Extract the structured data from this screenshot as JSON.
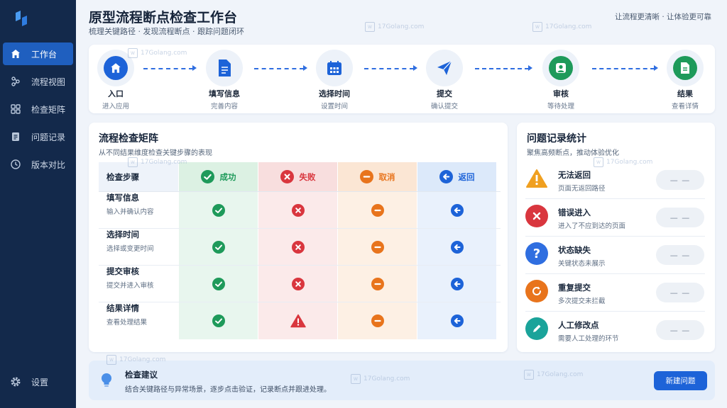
{
  "header": {
    "title": "原型流程断点检查工作台",
    "subtitle": "梳理关键路径 · 发现流程断点 · 跟踪问题闭环",
    "right_text": "让流程更清晰 · 让体验更可靠"
  },
  "sidebar": {
    "items": [
      {
        "label": "工作台",
        "icon": "home-icon"
      },
      {
        "label": "流程视图",
        "icon": "flow-icon"
      },
      {
        "label": "检查矩阵",
        "icon": "grid-icon"
      },
      {
        "label": "问题记录",
        "icon": "record-icon"
      },
      {
        "label": "版本对比",
        "icon": "clock-icon"
      }
    ],
    "bottom": {
      "label": "设置",
      "icon": "gear-icon"
    }
  },
  "flow": {
    "steps": [
      {
        "label": "入口",
        "sub": "进入应用",
        "icon": "home-icon",
        "color": "#1d63d8"
      },
      {
        "label": "填写信息",
        "sub": "完善内容",
        "icon": "document-icon",
        "color": "#1d63d8"
      },
      {
        "label": "选择时间",
        "sub": "设置时间",
        "icon": "calendar-icon",
        "color": "#1d63d8"
      },
      {
        "label": "提交",
        "sub": "确认提交",
        "icon": "send-icon",
        "color": "#1d63d8"
      },
      {
        "label": "审核",
        "sub": "等待处理",
        "icon": "user-icon",
        "color": "#1e9a5a"
      },
      {
        "label": "结果",
        "sub": "查看详情",
        "icon": "file-icon",
        "color": "#1e9a5a"
      }
    ]
  },
  "matrix": {
    "title": "流程检查矩阵",
    "subtitle": "从不同结果维度检查关键步骤的表现",
    "header_first": "检查步骤",
    "columns": [
      {
        "label": "成功",
        "color": "#1e9a5a",
        "icon": "check-icon"
      },
      {
        "label": "失败",
        "color": "#d9363e",
        "icon": "x-icon"
      },
      {
        "label": "取消",
        "color": "#e8741c",
        "icon": "minus-icon"
      },
      {
        "label": "返回",
        "color": "#1d63d8",
        "icon": "back-arrow-icon"
      }
    ],
    "rows": [
      {
        "title": "填写信息",
        "sub": "输入并确认内容",
        "cells": [
          "check",
          "x",
          "minus",
          "back"
        ]
      },
      {
        "title": "选择时间",
        "sub": "选择或变更时间",
        "cells": [
          "check",
          "x",
          "minus",
          "back"
        ]
      },
      {
        "title": "提交审核",
        "sub": "提交并进入审核",
        "cells": [
          "check",
          "x",
          "minus",
          "back"
        ]
      },
      {
        "title": "结果详情",
        "sub": "查看处理结果",
        "cells": [
          "check",
          "warning",
          "minus",
          "back"
        ]
      }
    ]
  },
  "issues": {
    "title": "问题记录统计",
    "subtitle": "聚焦高频断点，推动体验优化",
    "items": [
      {
        "title": "无法返回",
        "sub": "页面无返回路径",
        "value": "— —",
        "icon": "warning-icon",
        "color": "#f0a020"
      },
      {
        "title": "错误进入",
        "sub": "进入了不应到达的页面",
        "value": "— —",
        "icon": "x-icon",
        "color": "#d9363e"
      },
      {
        "title": "状态缺失",
        "sub": "关键状态未展示",
        "value": "— —",
        "icon": "question-icon",
        "color": "#2f6ee0"
      },
      {
        "title": "重复提交",
        "sub": "多次提交未拦截",
        "value": "— —",
        "icon": "refresh-icon",
        "color": "#e8741c"
      },
      {
        "title": "人工修改点",
        "sub": "需要人工处理的环节",
        "value": "— —",
        "icon": "pencil-icon",
        "color": "#1aa39a"
      }
    ]
  },
  "suggestion": {
    "title": "检查建议",
    "text": "结合关键路径与异常场景，逐步点击验证，记录断点并跟进处理。",
    "button": "新建问题"
  },
  "watermark": {
    "text": "17Golang.com"
  }
}
